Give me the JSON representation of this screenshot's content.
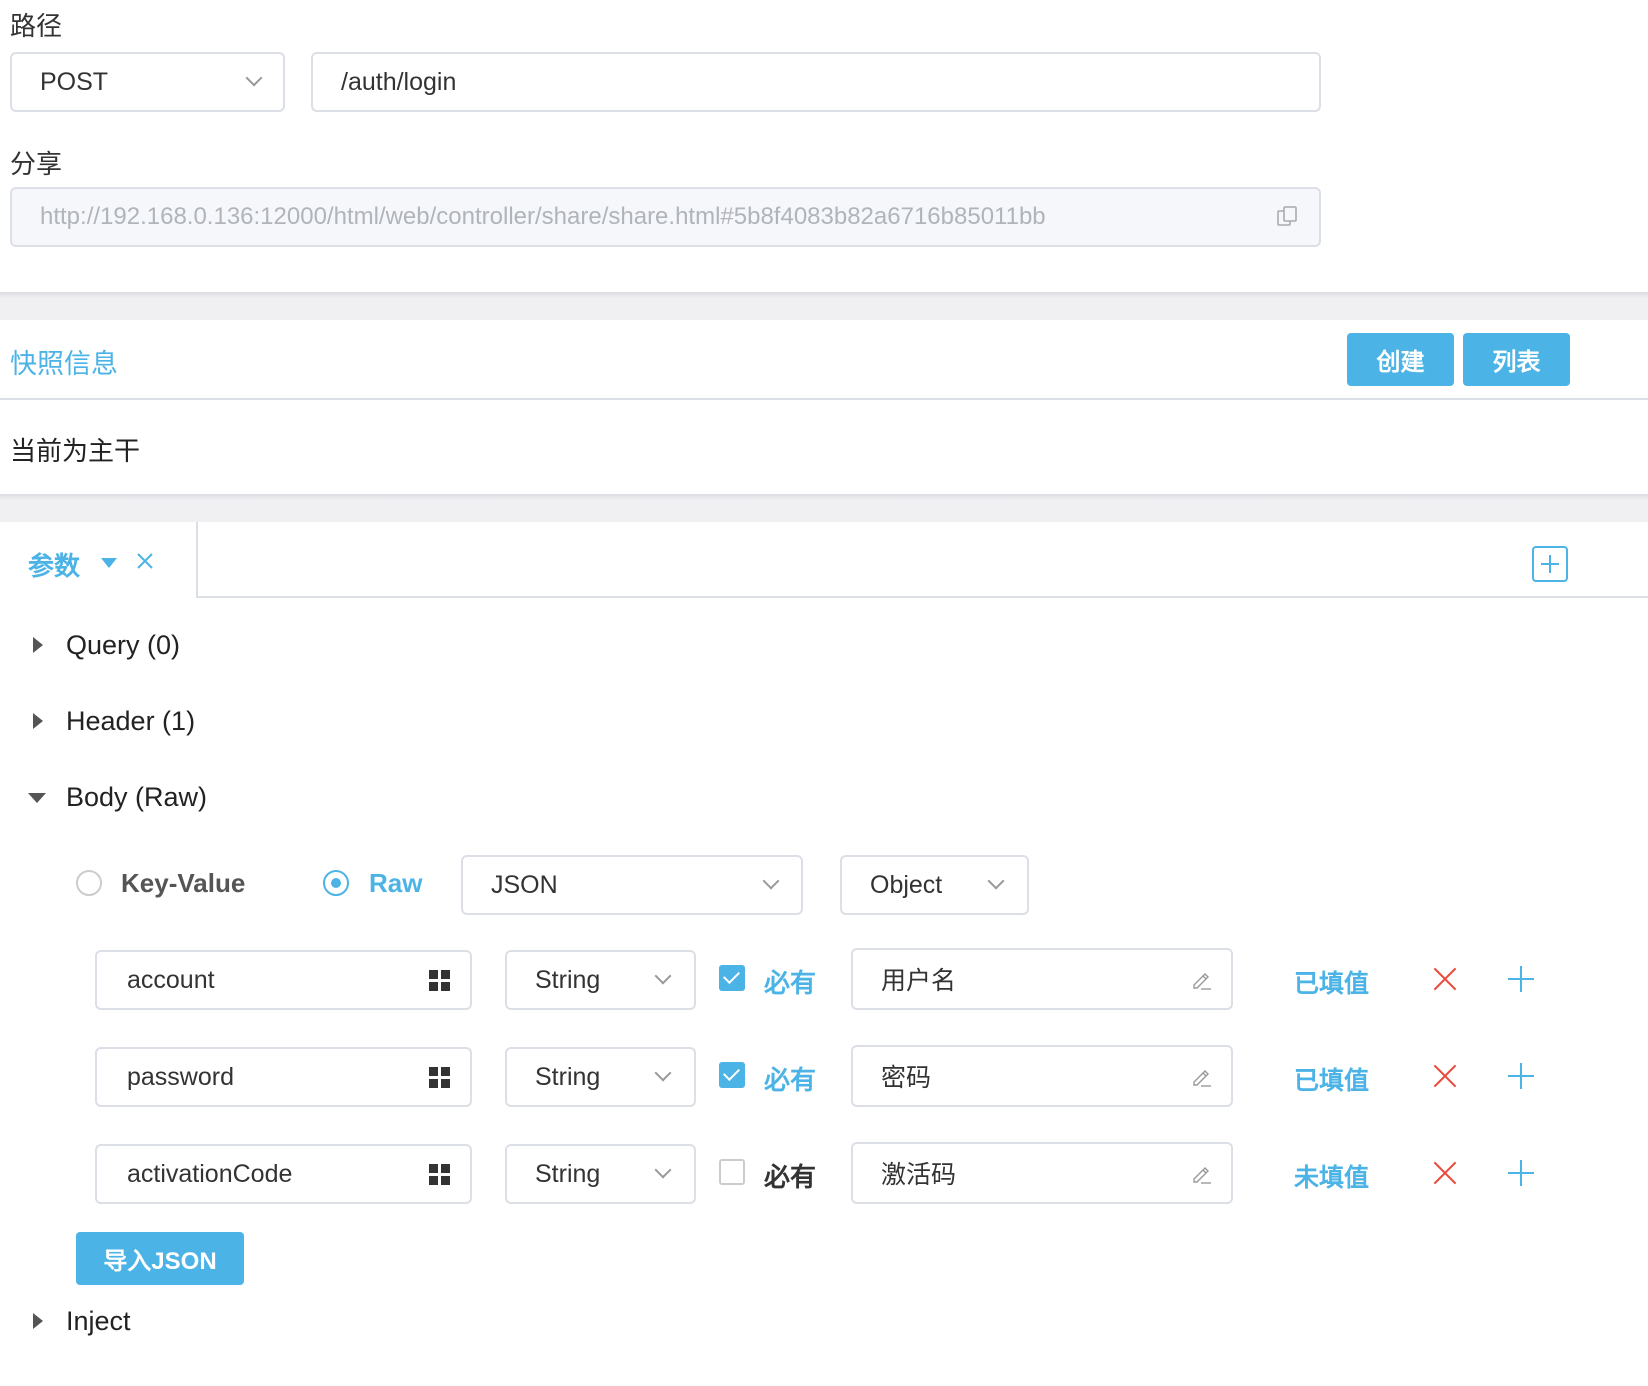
{
  "path_section": {
    "label": "路径",
    "method": "POST",
    "url": "/auth/login"
  },
  "share_section": {
    "label": "分享",
    "url": "http://192.168.0.136:12000/html/web/controller/share/share.html#5b8f4083b82a6716b85011bb"
  },
  "snapshot": {
    "title": "快照信息",
    "create_label": "创建",
    "list_label": "列表",
    "status_text": "当前为主干"
  },
  "params_tab": {
    "label": "参数"
  },
  "sections": {
    "query": "Query (0)",
    "header": "Header (1)",
    "body": "Body (Raw)",
    "inject": "Inject"
  },
  "body_options": {
    "key_value_label": "Key-Value",
    "raw_label": "Raw",
    "format": "JSON",
    "root_type": "Object"
  },
  "body_rows": [
    {
      "name": "account",
      "type": "String",
      "required_label": "必有",
      "required": true,
      "desc": "用户名",
      "status": "已填值"
    },
    {
      "name": "password",
      "type": "String",
      "required_label": "必有",
      "required": true,
      "desc": "密码",
      "status": "已填值"
    },
    {
      "name": "activationCode",
      "type": "String",
      "required_label": "必有",
      "required": false,
      "desc": "激活码",
      "status": "未填值"
    }
  ],
  "import_button": "导入JSON",
  "colors": {
    "accent": "#4cb3e6",
    "delete": "#e84c3d",
    "border": "#dcdfe6"
  }
}
